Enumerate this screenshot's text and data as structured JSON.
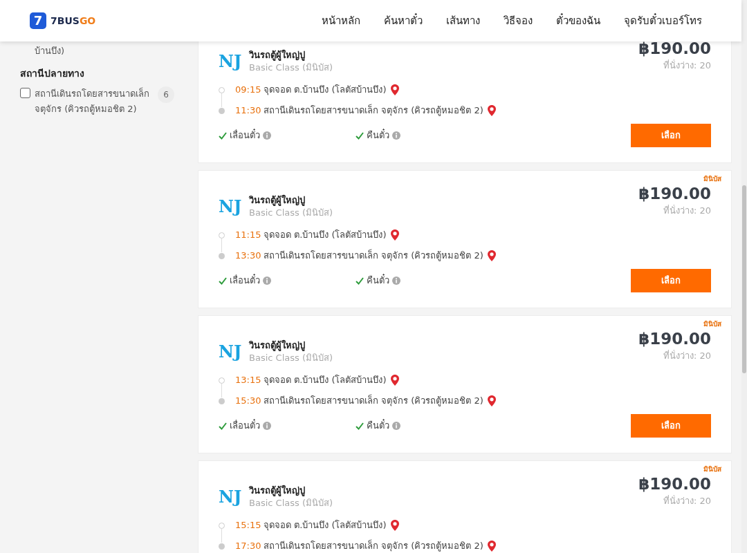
{
  "header": {
    "logo": {
      "mark": "7",
      "text_a": "7BUS",
      "text_b": "GO"
    },
    "nav": [
      {
        "label": "หน้าหลัก"
      },
      {
        "label": "ค้นหาตั๋ว"
      },
      {
        "label": "เส้นทาง"
      },
      {
        "label": "วิธีจอง"
      },
      {
        "label": "ตั๋วของฉัน"
      },
      {
        "label": "จุดรับตั๋วเบอร์โทร"
      }
    ]
  },
  "sidebar": {
    "cut_text": "บ้านบึง)",
    "section_title": "สถานีปลายทาง",
    "filters": [
      {
        "label": "สถานีเดินรถโดยสารขนาดเล็ก จตุจักร (คิวรถตู้หมอชิต 2)",
        "count": "6",
        "checked": false
      }
    ]
  },
  "trips": [
    {
      "operator_logo": "NJ",
      "operator": "วินรถตู้ผู้ใหญ่ปู",
      "class": "Basic Class (มินิบัส)",
      "price": "฿190.00",
      "seats": "ที่นั่งว่าง: 20",
      "stops": [
        {
          "time": "09:15",
          "place": "จุดจอด ต.บ้านบึง (โลตัสบ้านบึง)",
          "kind": "departure"
        },
        {
          "time": "11:30",
          "place": "สถานีเดินรถโดยสารขนาดเล็ก จตุจักร (คิวรถตู้หมอชิต 2)",
          "kind": "arrival"
        }
      ],
      "features": [
        "เลื่อนตั๋ว",
        "คืนตั๋ว"
      ],
      "button": "เลือก"
    },
    {
      "tag": "มินิบัส",
      "operator_logo": "NJ",
      "operator": "วินรถตู้ผู้ใหญ่ปู",
      "class": "Basic Class (มินิบัส)",
      "price": "฿190.00",
      "seats": "ที่นั่งว่าง: 20",
      "stops": [
        {
          "time": "11:15",
          "place": "จุดจอด ต.บ้านบึง (โลตัสบ้านบึง)",
          "kind": "departure"
        },
        {
          "time": "13:30",
          "place": "สถานีเดินรถโดยสารขนาดเล็ก จตุจักร (คิวรถตู้หมอชิต 2)",
          "kind": "arrival"
        }
      ],
      "features": [
        "เลื่อนตั๋ว",
        "คืนตั๋ว"
      ],
      "button": "เลือก"
    },
    {
      "tag": "มินิบัส",
      "operator_logo": "NJ",
      "operator": "วินรถตู้ผู้ใหญ่ปู",
      "class": "Basic Class (มินิบัส)",
      "price": "฿190.00",
      "seats": "ที่นั่งว่าง: 20",
      "stops": [
        {
          "time": "13:15",
          "place": "จุดจอด ต.บ้านบึง (โลตัสบ้านบึง)",
          "kind": "departure"
        },
        {
          "time": "15:30",
          "place": "สถานีเดินรถโดยสารขนาดเล็ก จตุจักร (คิวรถตู้หมอชิต 2)",
          "kind": "arrival"
        }
      ],
      "features": [
        "เลื่อนตั๋ว",
        "คืนตั๋ว"
      ],
      "button": "เลือก"
    },
    {
      "tag": "มินิบัส",
      "operator_logo": "NJ",
      "operator": "วินรถตู้ผู้ใหญ่ปู",
      "class": "Basic Class (มินิบัส)",
      "price": "฿190.00",
      "seats": "ที่นั่งว่าง: 20",
      "stops": [
        {
          "time": "15:15",
          "place": "จุดจอด ต.บ้านบึง (โลตัสบ้านบึง)",
          "kind": "departure"
        },
        {
          "time": "17:30",
          "place": "สถานีเดินรถโดยสารขนาดเล็ก จตุจักร (คิวรถตู้หมอชิต 2)",
          "kind": "arrival"
        }
      ]
    }
  ]
}
